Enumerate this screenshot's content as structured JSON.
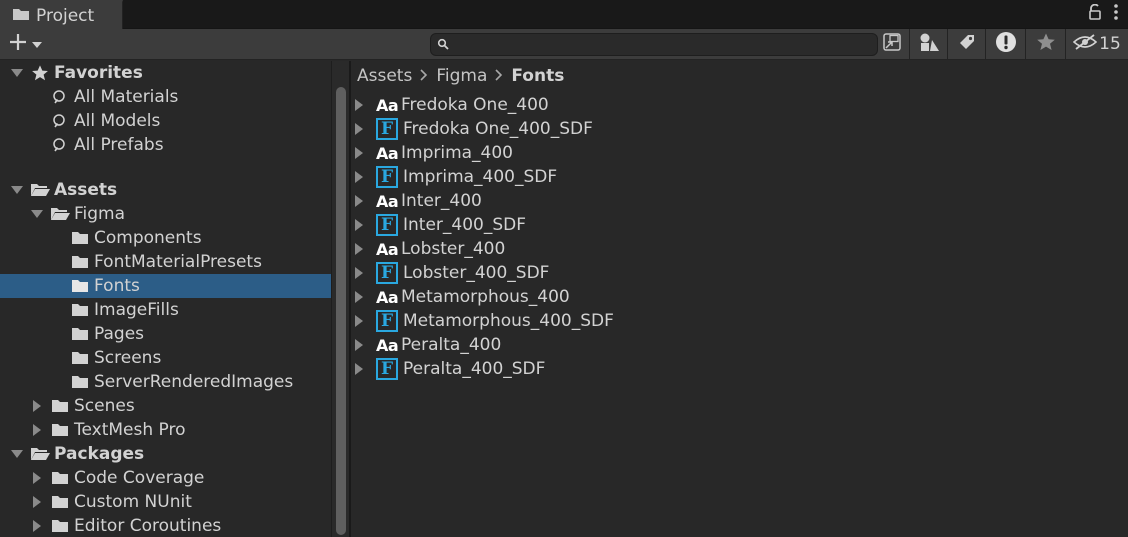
{
  "window": {
    "tab_title": "Project"
  },
  "toolbar": {
    "search": {
      "value": "",
      "placeholder": ""
    },
    "hidden_count": "15"
  },
  "tree": {
    "favorites": {
      "label": "Favorites",
      "items": [
        "All Materials",
        "All Models",
        "All Prefabs"
      ]
    },
    "assets": {
      "label": "Assets",
      "figma": {
        "label": "Figma",
        "children": [
          "Components",
          "FontMaterialPresets",
          "Fonts",
          "ImageFills",
          "Pages",
          "Screens",
          "ServerRenderedImages"
        ],
        "selected": "Fonts"
      },
      "others": [
        "Scenes",
        "TextMesh Pro"
      ]
    },
    "packages": {
      "label": "Packages",
      "items": [
        "Code Coverage",
        "Custom NUnit",
        "Editor Coroutines"
      ]
    }
  },
  "breadcrumb": [
    "Assets",
    "Figma",
    "Fonts"
  ],
  "files": [
    {
      "name": "Fredoka One_400",
      "kind": "font"
    },
    {
      "name": "Fredoka One_400_SDF",
      "kind": "sdf"
    },
    {
      "name": "Imprima_400",
      "kind": "font"
    },
    {
      "name": "Imprima_400_SDF",
      "kind": "sdf"
    },
    {
      "name": "Inter_400",
      "kind": "font"
    },
    {
      "name": "Inter_400_SDF",
      "kind": "sdf"
    },
    {
      "name": "Lobster_400",
      "kind": "font"
    },
    {
      "name": "Lobster_400_SDF",
      "kind": "sdf"
    },
    {
      "name": "Metamorphous_400",
      "kind": "font"
    },
    {
      "name": "Metamorphous_400_SDF",
      "kind": "sdf"
    },
    {
      "name": "Peralta_400",
      "kind": "font"
    },
    {
      "name": "Peralta_400_SDF",
      "kind": "sdf"
    }
  ],
  "icons": {
    "font_glyph": "Aa",
    "sdf_glyph": "F"
  },
  "colors": {
    "selection": "#2c5d87",
    "sdf_accent": "#2aa8e0"
  }
}
